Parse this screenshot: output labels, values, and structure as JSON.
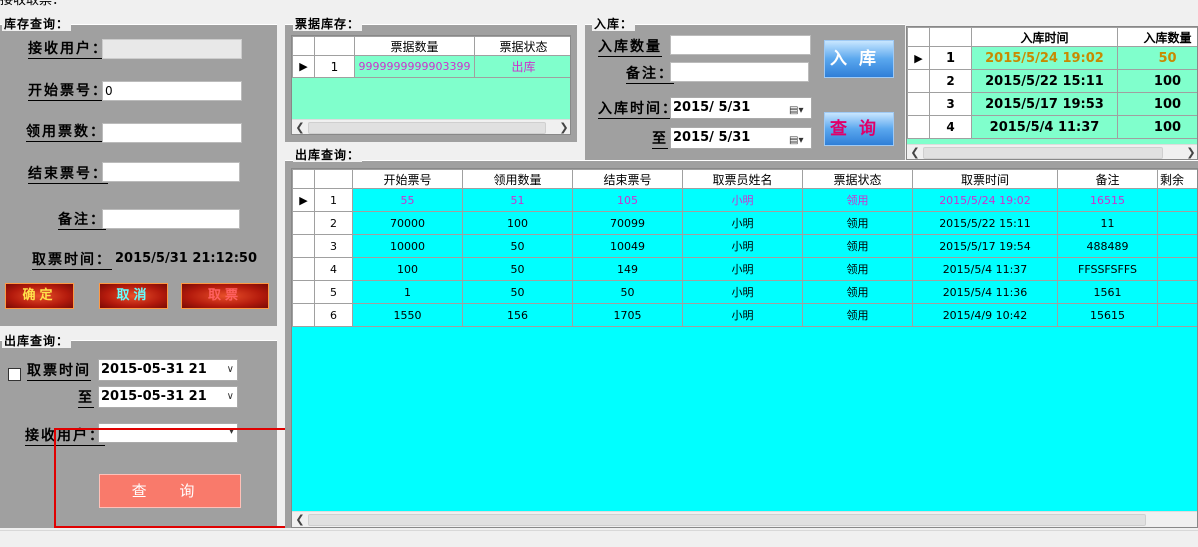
{
  "window": {
    "title": "接收取票："
  },
  "stock_query": {
    "title": "库存查询：",
    "receiver_label": "接收用户：",
    "receiver_value": "",
    "start_no_label": "开始票号：",
    "start_no_value": "0",
    "claim_count_label": "领用票数：",
    "claim_count_value": "",
    "end_no_label": "结束票号：",
    "end_no_value": "",
    "note_label": "备注：",
    "note_value": "",
    "take_time_label": "取票时间：",
    "take_time_value": "2015/5/31 21:12:50",
    "confirm_label": "确定",
    "cancel_label": "取消",
    "take_label": "取票"
  },
  "outbound_query_left": {
    "title": "出库查询：",
    "take_time_label": "取票时间",
    "from_value": "2015-05-31 21",
    "to_label": "至",
    "to_value": "2015-05-31 21",
    "receiver_label": "接收用户：",
    "receiver_value": "",
    "query_label": "查 询"
  },
  "ticket_stock": {
    "title": "票据库存：",
    "columns": [
      "票据数量",
      "票据状态"
    ],
    "rows": [
      {
        "no": "1",
        "qty": "9999999999903399",
        "status": "出库"
      }
    ]
  },
  "inbound": {
    "title": "入库：",
    "qty_label": "入库数量",
    "qty_value": "",
    "note_label": "备注：",
    "note_value": "",
    "time_label": "入库时间：",
    "time_value": "2015/ 5/31",
    "to_label": "至",
    "to_value": "2015/ 5/31",
    "inbound_btn": "入库",
    "query_btn": "查询",
    "columns": [
      "入库时间",
      "入库数量"
    ],
    "rows": [
      {
        "no": "1",
        "time": "2015/5/24 19:02",
        "qty": "50"
      },
      {
        "no": "2",
        "time": "2015/5/22 15:11",
        "qty": "100"
      },
      {
        "no": "3",
        "time": "2015/5/17 19:53",
        "qty": "100"
      },
      {
        "no": "4",
        "time": "2015/5/4 11:37",
        "qty": "100"
      }
    ]
  },
  "outbound_grid": {
    "title": "出库查询：",
    "columns": [
      "开始票号",
      "领用数量",
      "结束票号",
      "取票员姓名",
      "票据状态",
      "取票时间",
      "备注",
      "剩余"
    ],
    "rows": [
      {
        "no": "1",
        "start": "55",
        "qty": "51",
        "end": "105",
        "name": "小明",
        "status": "领用",
        "time": "2015/5/24 19:02",
        "note": "16515"
      },
      {
        "no": "2",
        "start": "70000",
        "qty": "100",
        "end": "70099",
        "name": "小明",
        "status": "领用",
        "time": "2015/5/22 15:11",
        "note": "11"
      },
      {
        "no": "3",
        "start": "10000",
        "qty": "50",
        "end": "10049",
        "name": "小明",
        "status": "领用",
        "time": "2015/5/17 19:54",
        "note": "488489"
      },
      {
        "no": "4",
        "start": "100",
        "qty": "50",
        "end": "149",
        "name": "小明",
        "status": "领用",
        "time": "2015/5/4 11:37",
        "note": "FFSSFSFFS"
      },
      {
        "no": "5",
        "start": "1",
        "qty": "50",
        "end": "50",
        "name": "小明",
        "status": "领用",
        "time": "2015/5/4 11:36",
        "note": "1561"
      },
      {
        "no": "6",
        "start": "1550",
        "qty": "156",
        "end": "1705",
        "name": "小明",
        "status": "领用",
        "time": "2015/4/9 10:42",
        "note": "15615"
      }
    ]
  },
  "colors": {
    "panel_gray": "#a0a0a0",
    "grid_cyan": "#00ffff",
    "grid_mint": "#80ffcc",
    "selected_text": "#cc33cc",
    "annotation_red": "#e00000"
  }
}
